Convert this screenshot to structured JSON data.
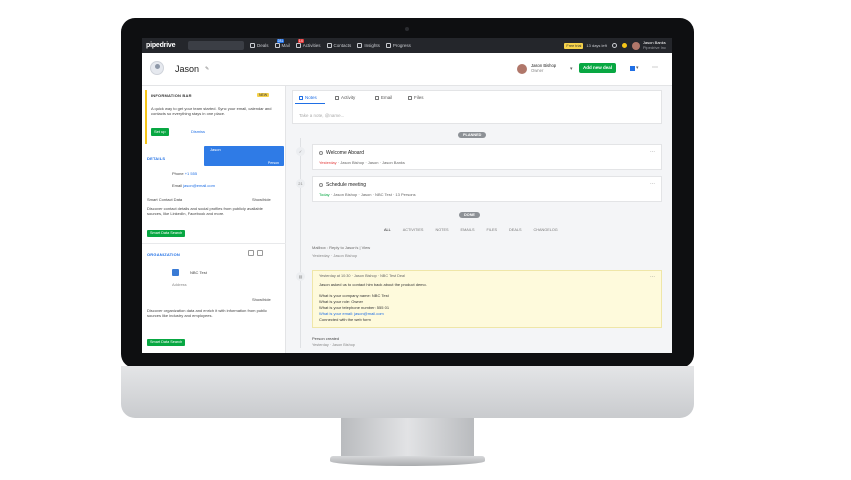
{
  "topbar": {
    "logo": "pipedrive",
    "nav": [
      {
        "label": "Deals",
        "icon": "deals-icon"
      },
      {
        "label": "Mail",
        "icon": "mail-icon",
        "badge": "281"
      },
      {
        "label": "Activities",
        "icon": "activities-icon",
        "badge": "14"
      },
      {
        "label": "Contacts",
        "icon": "contacts-icon"
      },
      {
        "label": "Insights",
        "icon": "insights-icon"
      },
      {
        "label": "Progress",
        "icon": "progress-icon"
      }
    ],
    "trial_badge": "Free trial",
    "trial_text": "13 days left",
    "user_name": "Jason Banks",
    "user_company": "Pipedrive Inc"
  },
  "header": {
    "title": "Jason",
    "owner_name": "Jason Bishop",
    "owner_sub": "Owner",
    "add_deal_label": "Add new deal"
  },
  "left": {
    "ai_title": "INFORMATION BAR",
    "ai_badge": "NEW",
    "ai_text": "A quick way to get your team started. Sync your email, calendar and contacts so everything stays in one place.",
    "ai_setup": "Set up",
    "ai_dismiss": "Dismiss",
    "popover_title": "Jason",
    "popover_note": "Person",
    "details_title": "DETAILS",
    "phone_label": "Phone",
    "phone_value": "+1 555",
    "email_label": "Email",
    "email_value": "jason@email.com",
    "smart_title": "Smart Contact Data",
    "smart_text": "Discover contact details and social profiles from publicly available sources, like LinkedIn, Facebook and more.",
    "showhide": "Show/hide",
    "smart_btn": "Smart Data Search",
    "org_title": "ORGANIZATION",
    "org_name": "NBC Test",
    "org_sub": "Address",
    "org_showhide": "Show/hide",
    "org_text": "Discover organization data and enrich it with information from public sources like industry and employees.",
    "org_btn": "Smart Data Search"
  },
  "main": {
    "tabs": [
      "Notes",
      "Activity",
      "Email",
      "Files"
    ],
    "note_placeholder": "Take a note, @name...",
    "planned_label": "PLANNED",
    "activities": [
      {
        "title": "Welcome Aboard",
        "due": "Yesterday",
        "meta": "Jason Bishop · Jason · Jason Banks"
      },
      {
        "title": "Schedule meeting",
        "due": "Today",
        "meta": "Jason Bishop · Jason · NBC Test · 13 Persons"
      }
    ],
    "done_label": "DONE",
    "filters": [
      "ALL",
      "ACTIVITIES",
      "NOTES",
      "EMAILS",
      "FILES",
      "DEALS",
      "CHANGELOG"
    ],
    "history_1": "Mailbox : Reply to Jason's | View",
    "history_2": "Yesterday · Jason Bishop",
    "note_meta": "Yesterday at 10:30 · Jason Bishop · NBC Test Deal",
    "note_lines": [
      "Jason asked us to contact him back about the product demo.",
      "What is your company name: NBC Test",
      "What is your role: Owner",
      "What is your telephone number: 555 01",
      "What is your email: jason@mail.com",
      "Connected with the web form"
    ],
    "bottom_event": "Person created",
    "bottom_event_meta": "Yesterday · Jason Bishop"
  }
}
